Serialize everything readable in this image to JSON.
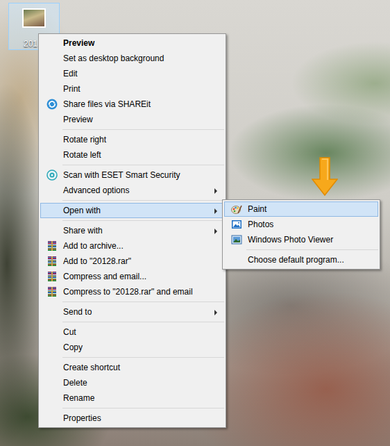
{
  "desktop_icon": {
    "label": "201",
    "selected": true
  },
  "context_menu": {
    "items": [
      {
        "kind": "item",
        "label": "Preview",
        "default": true,
        "submenu": false,
        "selected": false
      },
      {
        "kind": "item",
        "label": "Set as desktop background",
        "default": false,
        "submenu": false,
        "selected": false
      },
      {
        "kind": "item",
        "label": "Edit",
        "default": false,
        "submenu": false,
        "selected": false
      },
      {
        "kind": "item",
        "label": "Print",
        "default": false,
        "submenu": false,
        "selected": false
      },
      {
        "kind": "item",
        "label": "Share files via SHAREit",
        "default": false,
        "submenu": false,
        "selected": false
      },
      {
        "kind": "item",
        "label": "Preview",
        "default": false,
        "submenu": false,
        "selected": false
      },
      {
        "kind": "separator"
      },
      {
        "kind": "item",
        "label": "Rotate right",
        "default": false,
        "submenu": false,
        "selected": false
      },
      {
        "kind": "item",
        "label": "Rotate left",
        "default": false,
        "submenu": false,
        "selected": false
      },
      {
        "kind": "separator"
      },
      {
        "kind": "item",
        "label": "Scan with ESET Smart Security",
        "default": false,
        "submenu": false,
        "selected": false
      },
      {
        "kind": "item",
        "label": "Advanced options",
        "default": false,
        "submenu": true,
        "selected": false
      },
      {
        "kind": "separator"
      },
      {
        "kind": "item",
        "label": "Open with",
        "default": false,
        "submenu": true,
        "selected": true
      },
      {
        "kind": "separator"
      },
      {
        "kind": "item",
        "label": "Share with",
        "default": false,
        "submenu": true,
        "selected": false
      },
      {
        "kind": "item",
        "label": "Add to archive...",
        "default": false,
        "submenu": false,
        "selected": false
      },
      {
        "kind": "item",
        "label": "Add to \"20128.rar\"",
        "default": false,
        "submenu": false,
        "selected": false
      },
      {
        "kind": "item",
        "label": "Compress and email...",
        "default": false,
        "submenu": false,
        "selected": false
      },
      {
        "kind": "item",
        "label": "Compress to \"20128.rar\" and email",
        "default": false,
        "submenu": false,
        "selected": false
      },
      {
        "kind": "separator"
      },
      {
        "kind": "item",
        "label": "Send to",
        "default": false,
        "submenu": true,
        "selected": false
      },
      {
        "kind": "separator"
      },
      {
        "kind": "item",
        "label": "Cut",
        "default": false,
        "submenu": false,
        "selected": false
      },
      {
        "kind": "item",
        "label": "Copy",
        "default": false,
        "submenu": false,
        "selected": false
      },
      {
        "kind": "separator"
      },
      {
        "kind": "item",
        "label": "Create shortcut",
        "default": false,
        "submenu": false,
        "selected": false
      },
      {
        "kind": "item",
        "label": "Delete",
        "default": false,
        "submenu": false,
        "selected": false
      },
      {
        "kind": "item",
        "label": "Rename",
        "default": false,
        "submenu": false,
        "selected": false
      },
      {
        "kind": "separator"
      },
      {
        "kind": "item",
        "label": "Properties",
        "default": false,
        "submenu": false,
        "selected": false
      }
    ]
  },
  "open_with_menu": {
    "items": [
      {
        "kind": "item",
        "label": "Paint",
        "selected": true
      },
      {
        "kind": "item",
        "label": "Photos",
        "selected": false
      },
      {
        "kind": "item",
        "label": "Windows Photo Viewer",
        "selected": false
      },
      {
        "kind": "separator"
      },
      {
        "kind": "item",
        "label": "Choose default program...",
        "selected": false
      }
    ]
  }
}
